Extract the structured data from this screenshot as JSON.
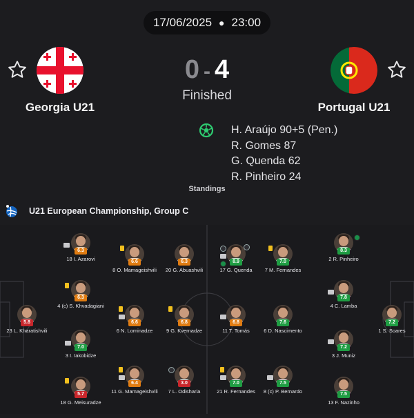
{
  "match": {
    "date": "17/06/2025",
    "time": "23:00",
    "home_score": "0",
    "away_score": "4",
    "status": "Finished",
    "standings_label": "Standings",
    "competition": "U21 European Championship, Group C"
  },
  "home": {
    "name": "Georgia U21",
    "flag_colors": [
      "#ffffff",
      "#e8112d"
    ]
  },
  "away": {
    "name": "Portugal U21",
    "flag_colors": [
      "#046a38",
      "#da291c",
      "#ffe900"
    ]
  },
  "scorers": [
    "H. Araújo 90+5 (Pen.)",
    "R. Gomes 87",
    "G. Quenda 62",
    "R. Pinheiro 24"
  ],
  "colors": {
    "rating_red": "#c8262b",
    "rating_orange": "#e07c12",
    "rating_green": "#1f9d43",
    "pitch_line": "#3a3a3f"
  },
  "lineup": [
    {
      "label": "18 I. Azarovi",
      "rating": "6.3",
      "color": "orange"
    },
    {
      "label": "8 O. Mamageishvili",
      "rating": "6.6",
      "color": "orange"
    },
    {
      "label": "20 G. Abuashvili",
      "rating": "6.3",
      "color": "orange"
    },
    {
      "label": "4 (c) S. Khvadagiani",
      "rating": "6.3",
      "color": "orange"
    },
    {
      "label": "23 L. Kharatishvili",
      "rating": "5.8",
      "color": "red"
    },
    {
      "label": "6 N. Lominadze",
      "rating": "6.6",
      "color": "orange"
    },
    {
      "label": "9 G. Kvernadze",
      "rating": "6.8",
      "color": "orange"
    },
    {
      "label": "3 I. Iakobidze",
      "rating": "7.0",
      "color": "green"
    },
    {
      "label": "11 G. Mamageishvili",
      "rating": "6.4",
      "color": "orange"
    },
    {
      "label": "7 L. Odisharia",
      "rating": "3.0",
      "color": "red"
    },
    {
      "label": "18 G. Meisuradze",
      "rating": "5.7",
      "color": "red"
    },
    {
      "label": "17 G. Quenda",
      "rating": "8.9",
      "color": "green"
    },
    {
      "label": "7 M. Fernandes",
      "rating": "7.0",
      "color": "green"
    },
    {
      "label": "2 R. Pinheiro",
      "rating": "8.3",
      "color": "green"
    },
    {
      "label": "11 T. Tomás",
      "rating": "6.8",
      "color": "orange"
    },
    {
      "label": "6 D. Nascimento",
      "rating": "7.6",
      "color": "green"
    },
    {
      "label": "4 C. Lamba",
      "rating": "7.8",
      "color": "green"
    },
    {
      "label": "1 S. Soares",
      "rating": "7.2",
      "color": "green"
    },
    {
      "label": "3 J. Muniz",
      "rating": "7.2",
      "color": "green"
    },
    {
      "label": "21 R. Fernandes",
      "rating": "7.0",
      "color": "green"
    },
    {
      "label": "8 (c) P. Bernardo",
      "rating": "7.5",
      "color": "green"
    },
    {
      "label": "13 F. Nazinho",
      "rating": "7.5",
      "color": "green"
    }
  ]
}
